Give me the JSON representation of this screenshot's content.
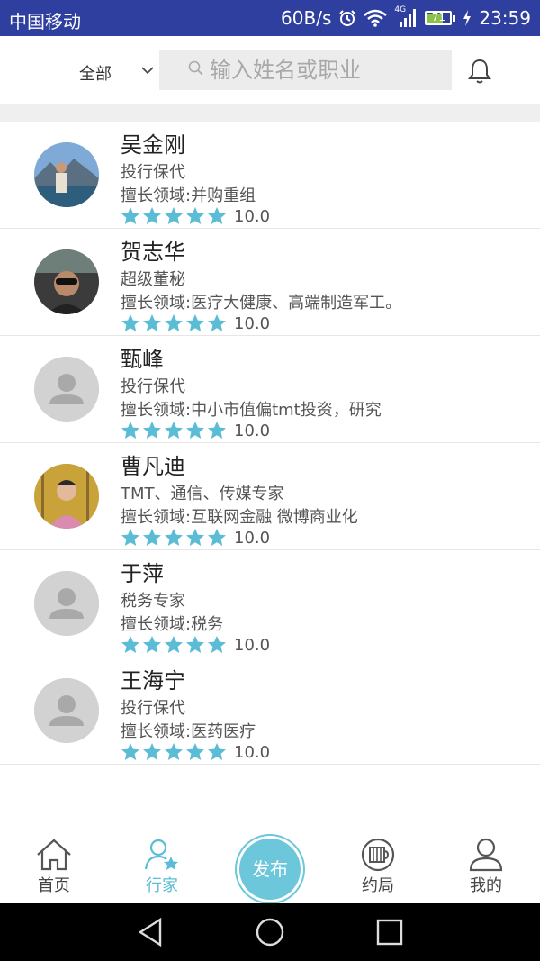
{
  "status": {
    "carrier": "中国移动",
    "speed": "60B/s",
    "network": "4G",
    "battery": "71",
    "battery_level": 0.71,
    "time": "23:59"
  },
  "topbar": {
    "filter_label": "全部",
    "search_placeholder": "输入姓名或职业"
  },
  "experts": [
    {
      "name": "吴金刚",
      "job": "投行保代",
      "field": "擅长领域:并购重组",
      "rating": 5,
      "score": "10.0",
      "avatar": "photo-outdoor"
    },
    {
      "name": "贺志华",
      "job": "超级董秘",
      "field": "擅长领域:医疗大健康、高端制造军工。",
      "rating": 5,
      "score": "10.0",
      "avatar": "photo-car"
    },
    {
      "name": "甄峰",
      "job": "投行保代",
      "field": "擅长领域:中小市值偏tmt投资，研究",
      "rating": 5,
      "score": "10.0",
      "avatar": "default"
    },
    {
      "name": "曹凡迪",
      "job": "TMT、通信、传媒专家",
      "field": "擅长领域:互联网金融 微博商业化",
      "rating": 5,
      "score": "10.0",
      "avatar": "photo-autumn"
    },
    {
      "name": "于萍",
      "job": "税务专家",
      "field": "擅长领域:税务",
      "rating": 5,
      "score": "10.0",
      "avatar": "default"
    },
    {
      "name": "王海宁",
      "job": "投行保代",
      "field": "擅长领域:医药医疗",
      "rating": 5,
      "score": "10.0",
      "avatar": "default"
    }
  ],
  "tabs": [
    {
      "label": "首页",
      "icon": "home-icon"
    },
    {
      "label": "行家",
      "icon": "expert-icon",
      "active": true
    },
    {
      "label": "发布",
      "icon": "publish"
    },
    {
      "label": "约局",
      "icon": "meeting-icon"
    },
    {
      "label": "我的",
      "icon": "profile-icon"
    }
  ],
  "colors": {
    "status_bar": "#2f3f9f",
    "accent": "#5bbcd6",
    "star": "#5bbcd6"
  }
}
